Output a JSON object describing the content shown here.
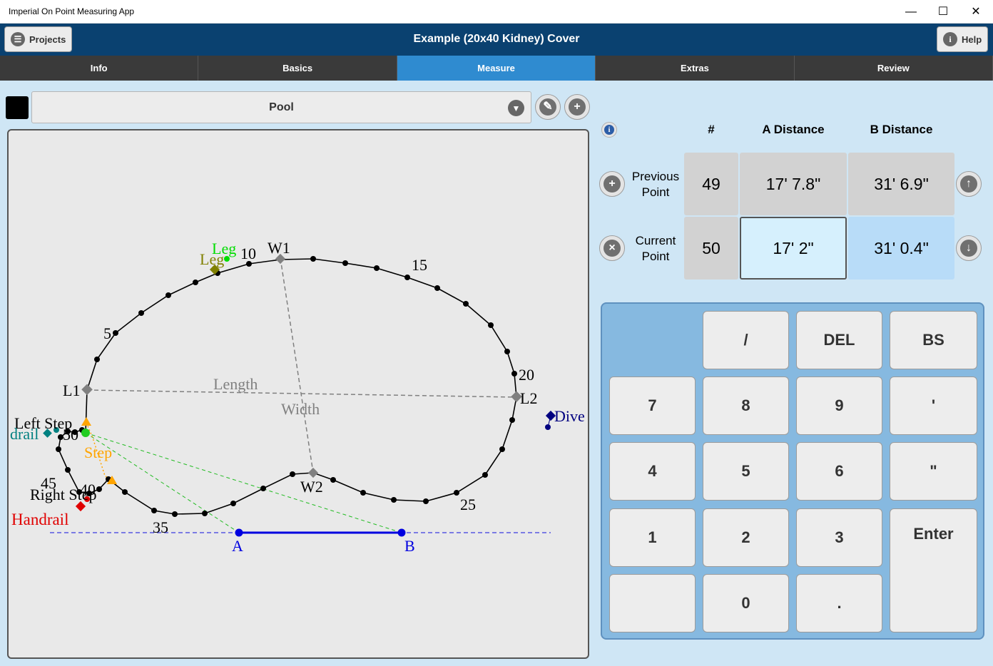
{
  "window": {
    "title": "Imperial On Point Measuring App",
    "minimize": "—",
    "maximize": "☐",
    "close": "✕"
  },
  "header": {
    "title": "Example (20x40 Kidney) Cover",
    "projects_label": "Projects",
    "help_label": "Help"
  },
  "tabs": [
    {
      "label": "Info",
      "active": false
    },
    {
      "label": "Basics",
      "active": false
    },
    {
      "label": "Measure",
      "active": true
    },
    {
      "label": "Extras",
      "active": false
    },
    {
      "label": "Review",
      "active": false
    }
  ],
  "shape_selector": {
    "selected": "Pool",
    "swatch_color": "#000000"
  },
  "icons": {
    "projects": "list-icon",
    "help": "info-icon",
    "edit": "pencil-icon",
    "add": "plus-icon",
    "dropdown": "chevron-down-icon"
  },
  "table": {
    "col_number": "#",
    "col_a": "A Distance",
    "col_b": "B Distance",
    "previous": {
      "label_line1": "Previous",
      "label_line2": "Point",
      "number": "49",
      "a": "17' 7.8\"",
      "b": "31' 6.9\""
    },
    "current": {
      "label_line1": "Current",
      "label_line2": "Point",
      "number": "50",
      "a": "17' 2\"",
      "b": "31' 0.4\""
    }
  },
  "keypad": {
    "slash": "/",
    "del": "DEL",
    "bs": "BS",
    "k7": "7",
    "k8": "8",
    "k9": "9",
    "ft": "'",
    "k4": "4",
    "k5": "5",
    "k6": "6",
    "inch": "\"",
    "k1": "1",
    "k2": "2",
    "k3": "3",
    "enter": "Enter",
    "k0": "0",
    "dot": "."
  },
  "drawing": {
    "point_labels": [
      "5",
      "10",
      "15",
      "20",
      "25",
      "35",
      "40",
      "45",
      "50"
    ],
    "reference_labels": {
      "w1": "W1",
      "w2": "W2",
      "l1": "L1",
      "l2": "L2",
      "length": "Length",
      "width": "Width"
    },
    "feature_labels": {
      "leg_green": "Leg",
      "leg_olive": "Leg",
      "left_step": "Left Step",
      "handrail_teal": "drail",
      "step": "Step",
      "right_step": "Right Step",
      "handrail_red": "Handrail",
      "dive": "Dive"
    },
    "baseline_labels": {
      "a": "A",
      "b": "B"
    },
    "colors": {
      "outline": "#000000",
      "reference": "#808080",
      "baseline": "#0000e0",
      "step": "#ffa500",
      "leg_green": "#00dd00",
      "leg_olive": "#808000",
      "handrail": "#e00000",
      "teal": "#008080",
      "dive": "#000080"
    }
  }
}
